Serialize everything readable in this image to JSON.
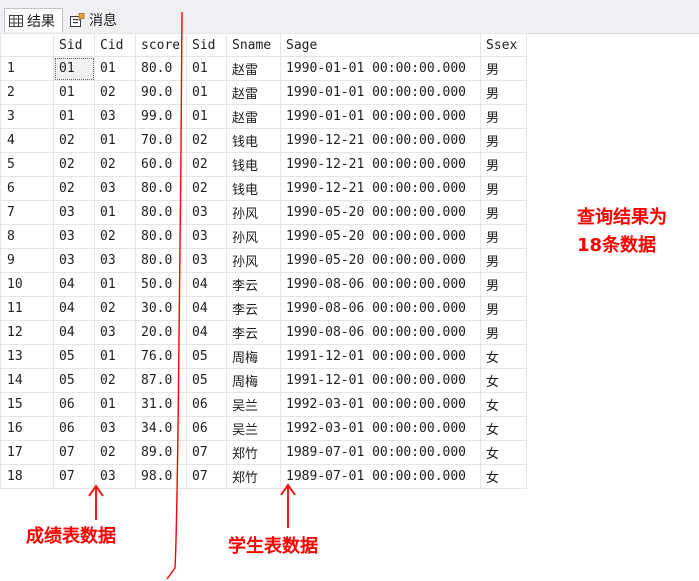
{
  "tabs": [
    {
      "label": "结果",
      "icon": "grid-icon"
    },
    {
      "label": "消息",
      "icon": "messages-icon"
    }
  ],
  "columns": [
    "",
    "Sid",
    "Cid",
    "score",
    "Sid",
    "Sname",
    "Sage",
    "Ssex"
  ],
  "rows": [
    [
      "1",
      "01",
      "01",
      "80.0",
      "01",
      "赵雷",
      "1990-01-01 00:00:00.000",
      "男"
    ],
    [
      "2",
      "01",
      "02",
      "90.0",
      "01",
      "赵雷",
      "1990-01-01 00:00:00.000",
      "男"
    ],
    [
      "3",
      "01",
      "03",
      "99.0",
      "01",
      "赵雷",
      "1990-01-01 00:00:00.000",
      "男"
    ],
    [
      "4",
      "02",
      "01",
      "70.0",
      "02",
      "钱电",
      "1990-12-21 00:00:00.000",
      "男"
    ],
    [
      "5",
      "02",
      "02",
      "60.0",
      "02",
      "钱电",
      "1990-12-21 00:00:00.000",
      "男"
    ],
    [
      "6",
      "02",
      "03",
      "80.0",
      "02",
      "钱电",
      "1990-12-21 00:00:00.000",
      "男"
    ],
    [
      "7",
      "03",
      "01",
      "80.0",
      "03",
      "孙风",
      "1990-05-20 00:00:00.000",
      "男"
    ],
    [
      "8",
      "03",
      "02",
      "80.0",
      "03",
      "孙风",
      "1990-05-20 00:00:00.000",
      "男"
    ],
    [
      "9",
      "03",
      "03",
      "80.0",
      "03",
      "孙风",
      "1990-05-20 00:00:00.000",
      "男"
    ],
    [
      "10",
      "04",
      "01",
      "50.0",
      "04",
      "李云",
      "1990-08-06 00:00:00.000",
      "男"
    ],
    [
      "11",
      "04",
      "02",
      "30.0",
      "04",
      "李云",
      "1990-08-06 00:00:00.000",
      "男"
    ],
    [
      "12",
      "04",
      "03",
      "20.0",
      "04",
      "李云",
      "1990-08-06 00:00:00.000",
      "男"
    ],
    [
      "13",
      "05",
      "01",
      "76.0",
      "05",
      "周梅",
      "1991-12-01 00:00:00.000",
      "女"
    ],
    [
      "14",
      "05",
      "02",
      "87.0",
      "05",
      "周梅",
      "1991-12-01 00:00:00.000",
      "女"
    ],
    [
      "15",
      "06",
      "01",
      "31.0",
      "06",
      "吴兰",
      "1992-03-01 00:00:00.000",
      "女"
    ],
    [
      "16",
      "06",
      "03",
      "34.0",
      "06",
      "吴兰",
      "1992-03-01 00:00:00.000",
      "女"
    ],
    [
      "17",
      "07",
      "02",
      "89.0",
      "07",
      "郑竹",
      "1989-07-01 00:00:00.000",
      "女"
    ],
    [
      "18",
      "07",
      "03",
      "98.0",
      "07",
      "郑竹",
      "1989-07-01 00:00:00.000",
      "女"
    ]
  ],
  "annotations": {
    "result_line1": "查询结果为",
    "result_line2": "18条数据",
    "score_data": "成绩表数据",
    "student_data": "学生表数据"
  },
  "colors": {
    "annotation": "#ff0000",
    "selection_border": "#6a6a6a"
  }
}
